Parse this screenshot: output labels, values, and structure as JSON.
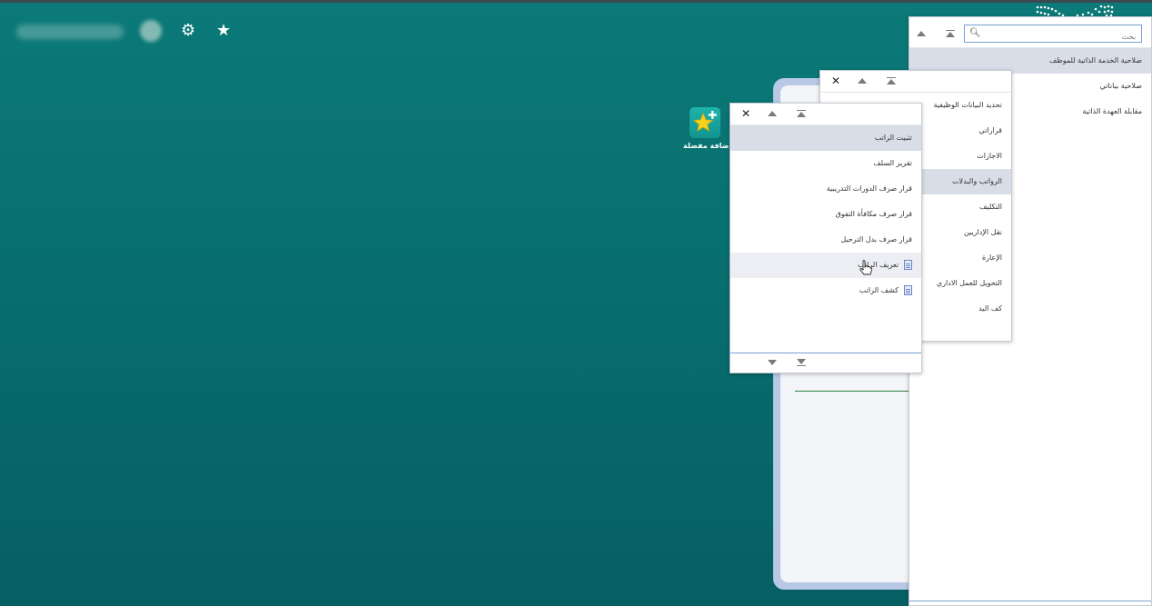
{
  "header": {
    "gear_icon": "gear-icon",
    "star_icon": "star-icon"
  },
  "desktop": {
    "shortcut": {
      "icon": "star-plus-icon",
      "label": "إضافة مفضلة"
    }
  },
  "panel1": {
    "search": {
      "placeholder": "بحث",
      "value": ""
    },
    "items": [
      {
        "label": "صلاحية الخدمة الذاتية للموظف",
        "selected": true
      },
      {
        "label": "صلاحية بياناتي",
        "selected": false
      },
      {
        "label": "مقابلة العهدة الذاتية",
        "selected": false
      }
    ]
  },
  "panel2": {
    "items": [
      {
        "label": "تحديد البيانات الوظيفية"
      },
      {
        "label": "قراراتي"
      },
      {
        "label": "الاجازات"
      },
      {
        "label": "الرواتب والبدلات",
        "selected": true
      },
      {
        "label": "التكليف"
      },
      {
        "label": "نقل الإداريين"
      },
      {
        "label": "الإعارة"
      },
      {
        "label": "التحويل للعمل الاداري"
      },
      {
        "label": "كف اليد"
      }
    ]
  },
  "panel3": {
    "items": [
      {
        "label": "تثبيت الراتب",
        "selected": true
      },
      {
        "label": "تقرير السلف"
      },
      {
        "label": "قرار صرف الدورات التدريبية"
      },
      {
        "label": "قرار صرف مكافأة التفوق"
      },
      {
        "label": "قرار صرف بدل الترحيل"
      },
      {
        "label": "تعريف الراتب",
        "icon": "document-icon",
        "hover": true
      },
      {
        "label": "كشف الراتب",
        "icon": "document-icon"
      }
    ]
  },
  "colors": {
    "background": "#087272",
    "selected_row": "#d8dde8",
    "accent_line": "#7aa0d4"
  }
}
